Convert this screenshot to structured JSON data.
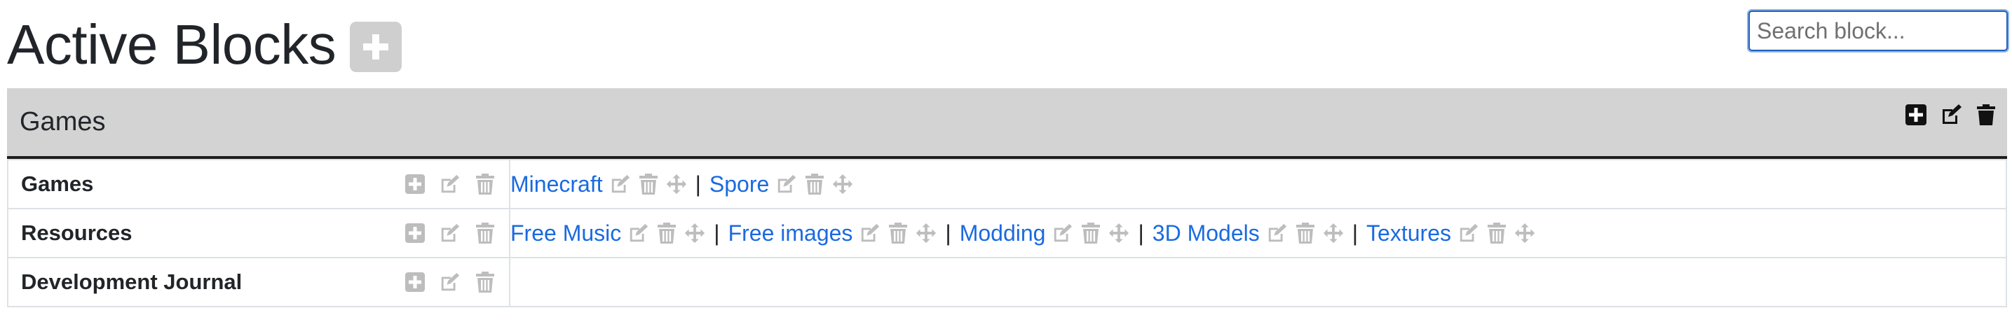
{
  "page": {
    "title": "Active Blocks",
    "add_icon": "plus-square-icon"
  },
  "search": {
    "placeholder": "Search block...",
    "value": ""
  },
  "block": {
    "title": "Games",
    "actions": [
      "add-icon",
      "edit-icon",
      "trash-icon"
    ],
    "categories": [
      {
        "name": "Games",
        "links": [
          {
            "label": "Minecraft"
          },
          {
            "label": "Spore"
          }
        ]
      },
      {
        "name": "Resources",
        "links": [
          {
            "label": "Free Music"
          },
          {
            "label": "Free images"
          },
          {
            "label": "Modding"
          },
          {
            "label": "3D Models"
          },
          {
            "label": "Textures"
          }
        ]
      },
      {
        "name": "Development Journal",
        "links": []
      }
    ],
    "separator": "|"
  },
  "colors": {
    "link": "#1a6ae0",
    "header_bg": "#d3d3d3",
    "muted_icon": "#bdbdbd",
    "add_btn_bg": "#cfcfcf"
  }
}
